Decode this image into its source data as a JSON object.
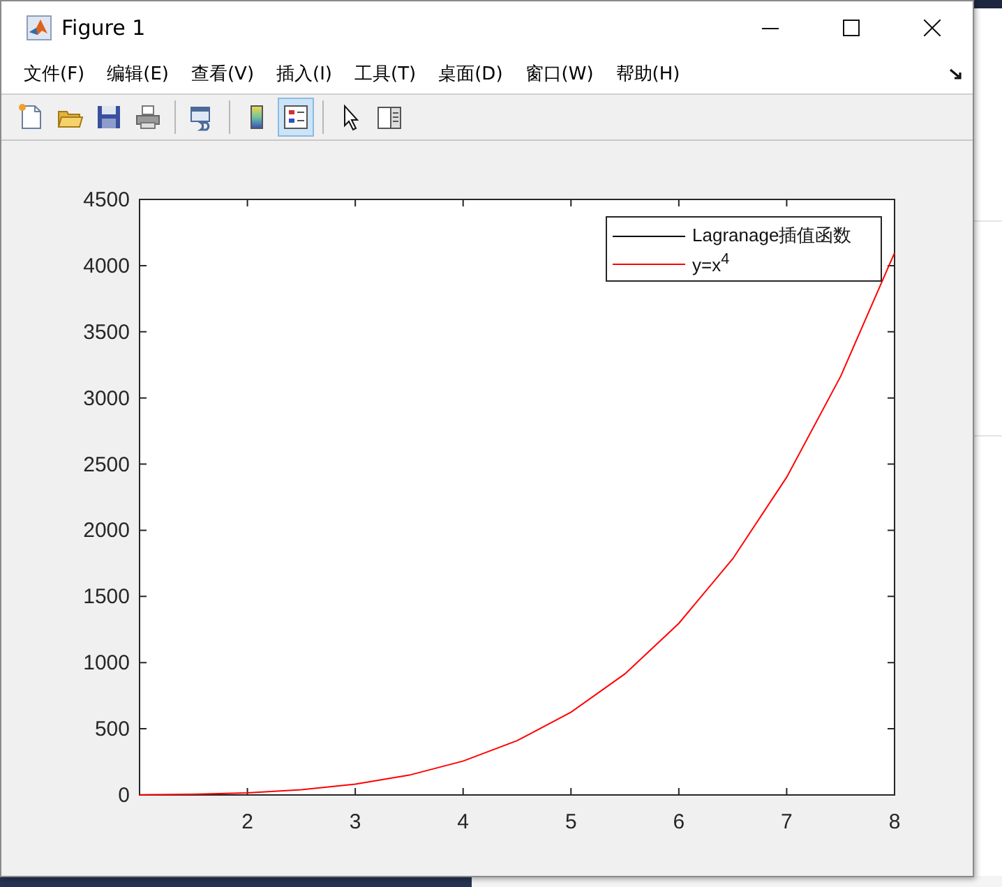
{
  "window": {
    "title": "Figure 1"
  },
  "menu": [
    {
      "label": "文件(F)"
    },
    {
      "label": "编辑(E)"
    },
    {
      "label": "查看(V)"
    },
    {
      "label": "插入(I)"
    },
    {
      "label": "工具(T)"
    },
    {
      "label": "桌面(D)"
    },
    {
      "label": "窗口(W)"
    },
    {
      "label": "帮助(H)"
    }
  ],
  "toolbar": [
    {
      "kind": "new",
      "selected": false
    },
    {
      "kind": "open",
      "selected": false
    },
    {
      "kind": "save",
      "selected": false
    },
    {
      "kind": "print",
      "selected": false
    },
    {
      "kind": "sep"
    },
    {
      "kind": "link",
      "selected": false
    },
    {
      "kind": "sep"
    },
    {
      "kind": "colorbar",
      "selected": false
    },
    {
      "kind": "legend",
      "selected": true
    },
    {
      "kind": "sep"
    },
    {
      "kind": "pointer",
      "selected": false
    },
    {
      "kind": "panel",
      "selected": false
    }
  ],
  "figure": {
    "chart_data": {
      "type": "line",
      "x": [
        1,
        1.5,
        2,
        2.5,
        3,
        3.5,
        4,
        4.5,
        5,
        5.5,
        6,
        6.5,
        7,
        7.5,
        8
      ],
      "series": [
        {
          "name": "Lagranage插值函数",
          "color": "#000000",
          "values": [
            null,
            null,
            null,
            null,
            null,
            null,
            null,
            null,
            null,
            null,
            null,
            null,
            null,
            null,
            null
          ]
        },
        {
          "name": "y=x$^{4}$",
          "color": "#ff0000",
          "values": [
            1,
            5,
            16,
            39,
            81,
            150,
            256,
            410,
            625,
            915,
            1296,
            1785,
            2401,
            3164,
            4096
          ]
        }
      ],
      "xlim": [
        1,
        8
      ],
      "ylim": [
        0,
        4500
      ],
      "xticks": [
        2,
        3,
        4,
        5,
        6,
        7,
        8
      ],
      "yticks": [
        0,
        500,
        1000,
        1500,
        2000,
        2500,
        3000,
        3500,
        4000,
        4500
      ]
    }
  }
}
